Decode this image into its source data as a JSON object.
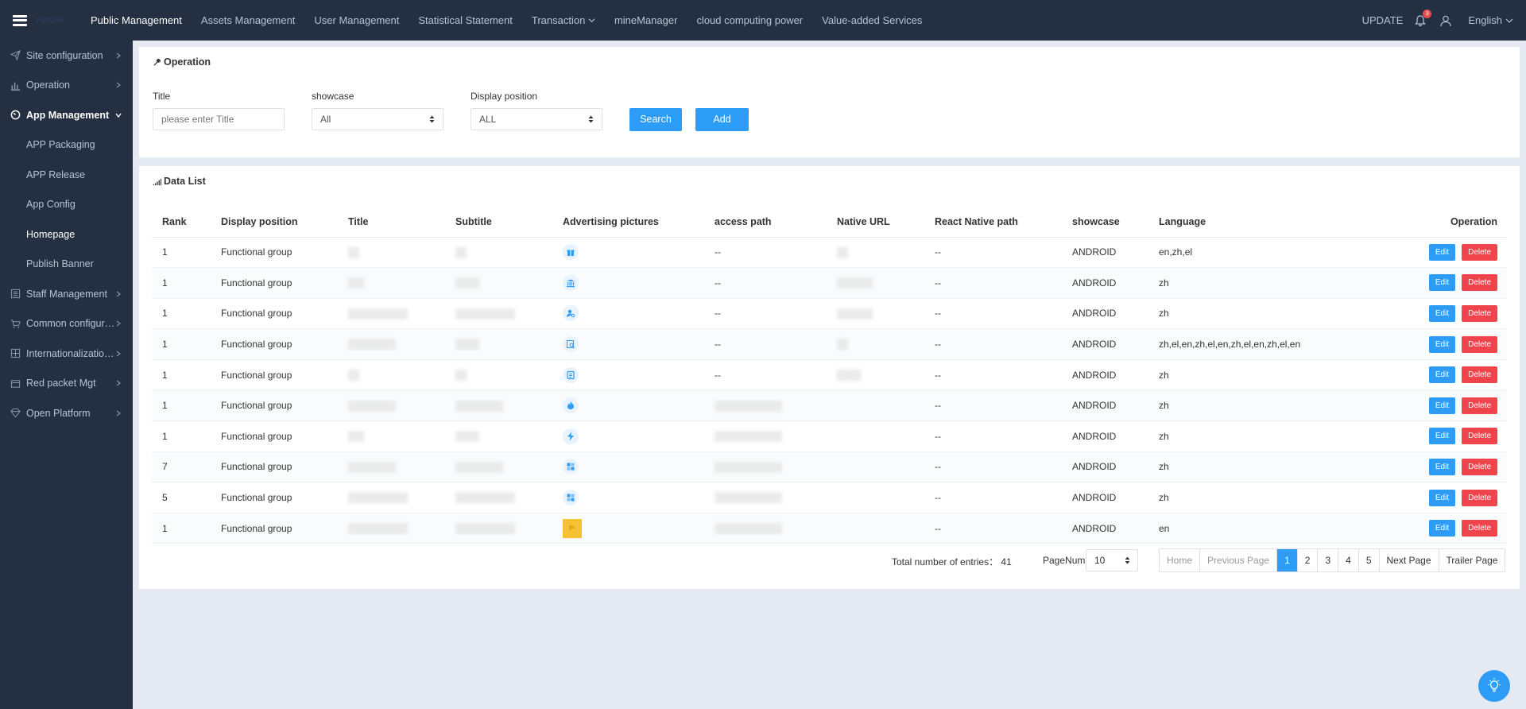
{
  "topnav": {
    "brand": "ISLUM",
    "items": [
      "Public Management",
      "Assets Management",
      "User Management",
      "Statistical Statement",
      "Transaction",
      "mineManager",
      "cloud computing power",
      "Value-added Services"
    ],
    "active_index": 0,
    "update_label": "UPDATE",
    "notif_count": "3",
    "language": "English"
  },
  "sidebar": {
    "items": [
      {
        "label": "Site configuration",
        "icon": "paper-plane-icon"
      },
      {
        "label": "Operation",
        "icon": "bar-chart-icon"
      },
      {
        "label": "App Management",
        "icon": "dashboard-icon"
      },
      {
        "label": "Staff Management",
        "icon": "list-icon"
      },
      {
        "label": "Common configura...",
        "icon": "cart-icon"
      },
      {
        "label": "Internationalization...",
        "icon": "grid-icon"
      },
      {
        "label": "Red packet Mgt",
        "icon": "wallet-icon"
      },
      {
        "label": "Open Platform",
        "icon": "diamond-icon"
      }
    ],
    "sub_items": [
      "APP Packaging",
      "APP Release",
      "App Config",
      "Homepage",
      "Publish Banner"
    ],
    "active_sub": 3
  },
  "operation": {
    "title": "Operation",
    "title_label": "Title",
    "title_placeholder": "please enter Title",
    "showcase_label": "showcase",
    "showcase_value": "All",
    "position_label": "Display position",
    "position_value": "ALL",
    "search_label": "Search",
    "add_label": "Add"
  },
  "datalist": {
    "title": "Data List",
    "columns": [
      "Rank",
      "Display position",
      "Title",
      "Subtitle",
      "Advertising pictures",
      "access path",
      "Native URL",
      "React Native path",
      "showcase",
      "Language",
      "Operation"
    ],
    "rows": [
      {
        "rank": "1",
        "position": "Functional group",
        "access": "--",
        "rn": "--",
        "showcase": "ANDROID",
        "lang": "en,zh,el",
        "pic": "gift-icon"
      },
      {
        "rank": "1",
        "position": "Functional group",
        "access": "--",
        "rn": "--",
        "showcase": "ANDROID",
        "lang": "zh",
        "pic": "bank-icon"
      },
      {
        "rank": "1",
        "position": "Functional group",
        "access": "--",
        "rn": "--",
        "showcase": "ANDROID",
        "lang": "zh",
        "pic": "user-search-icon"
      },
      {
        "rank": "1",
        "position": "Functional group",
        "access": "--",
        "rn": "--",
        "showcase": "ANDROID",
        "lang": "zh,el,en,zh,el,en,zh,el,en,zh,el,en",
        "pic": "search-doc-icon"
      },
      {
        "rank": "1",
        "position": "Functional group",
        "access": "--",
        "rn": "--",
        "showcase": "ANDROID",
        "lang": "zh",
        "pic": "document-icon"
      },
      {
        "rank": "1",
        "position": "Functional group",
        "access": "",
        "rn": "--",
        "showcase": "ANDROID",
        "lang": "zh",
        "pic": "fire-icon"
      },
      {
        "rank": "1",
        "position": "Functional group",
        "access": "",
        "rn": "--",
        "showcase": "ANDROID",
        "lang": "zh",
        "pic": "lightning-icon"
      },
      {
        "rank": "7",
        "position": "Functional group",
        "access": "",
        "rn": "--",
        "showcase": "ANDROID",
        "lang": "zh",
        "pic": "tiles-icon"
      },
      {
        "rank": "5",
        "position": "Functional group",
        "access": "",
        "rn": "--",
        "showcase": "ANDROID",
        "lang": "zh",
        "pic": "tiles-icon"
      },
      {
        "rank": "1",
        "position": "Functional group",
        "access": "",
        "rn": "--",
        "showcase": "ANDROID",
        "lang": "en",
        "pic": "banner-image-icon"
      }
    ],
    "edit_label": "Edit",
    "delete_label": "Delete"
  },
  "pagination": {
    "total_label": "Total number of entries： 41",
    "pagenum_label": "PageNum",
    "pagenum_value": "10",
    "home": "Home",
    "prev": "Previous Page",
    "pages": [
      "1",
      "2",
      "3",
      "4",
      "5"
    ],
    "active_page": "1",
    "next": "Next Page",
    "last": "Trailer Page"
  },
  "colors": {
    "nav_bg": "#243042",
    "primary": "#2d9cf6",
    "danger": "#f0444d",
    "page_bg": "#e4e9f2"
  }
}
